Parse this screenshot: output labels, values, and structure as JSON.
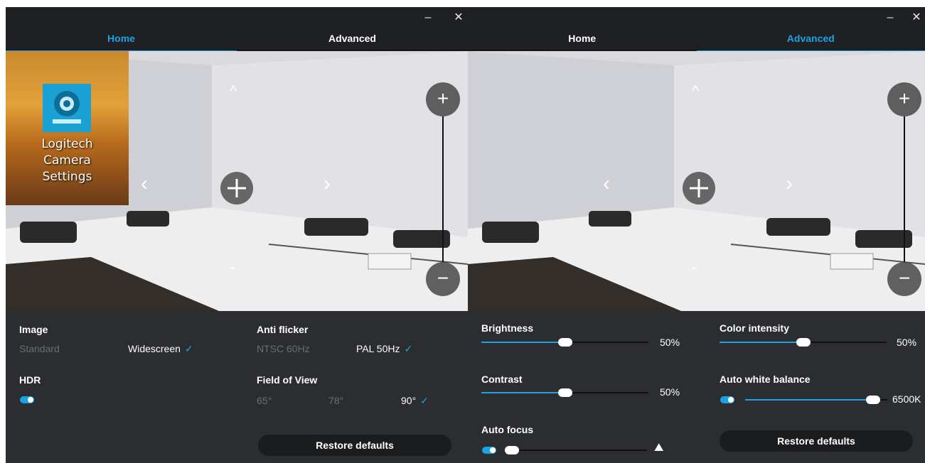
{
  "window_controls": {
    "minimize": "–",
    "close": "✕"
  },
  "tabs": {
    "home": "Home",
    "advanced": "Advanced"
  },
  "shortcut": {
    "label_line1": "Logitech",
    "label_line2": "Camera",
    "label_line3": "Settings"
  },
  "preview_controls": {
    "up": "^",
    "down": "ˇ",
    "left": "‹",
    "right": "›",
    "zoom_in": "+",
    "zoom_out": "−"
  },
  "home": {
    "image_label": "Image",
    "image_options": [
      "Standard",
      "Widescreen"
    ],
    "image_selected": "Widescreen",
    "hdr_label": "HDR",
    "hdr_on": true,
    "anti_flicker_label": "Anti flicker",
    "anti_flicker_options": [
      "NTSC 60Hz",
      "PAL 50Hz"
    ],
    "anti_flicker_selected": "PAL 50Hz",
    "fov_label": "Field of View",
    "fov_options": [
      "65°",
      "78°",
      "90°"
    ],
    "fov_selected": "90°",
    "restore": "Restore defaults"
  },
  "advanced": {
    "brightness_label": "Brightness",
    "brightness_value": "50%",
    "brightness_level": 0.5,
    "contrast_label": "Contrast",
    "contrast_value": "50%",
    "contrast_level": 0.5,
    "auto_focus_label": "Auto focus",
    "auto_focus_on": true,
    "focus_level": 0.05,
    "color_intensity_label": "Color intensity",
    "color_intensity_value": "50%",
    "color_intensity_level": 0.5,
    "auto_wb_label": "Auto white balance",
    "auto_wb_on": true,
    "wb_value": "6500K",
    "wb_level": 0.9,
    "restore": "Restore defaults"
  },
  "colors": {
    "accent": "#1aa2e3",
    "panel": "#2b2d30",
    "titlebar": "#1f2023"
  }
}
